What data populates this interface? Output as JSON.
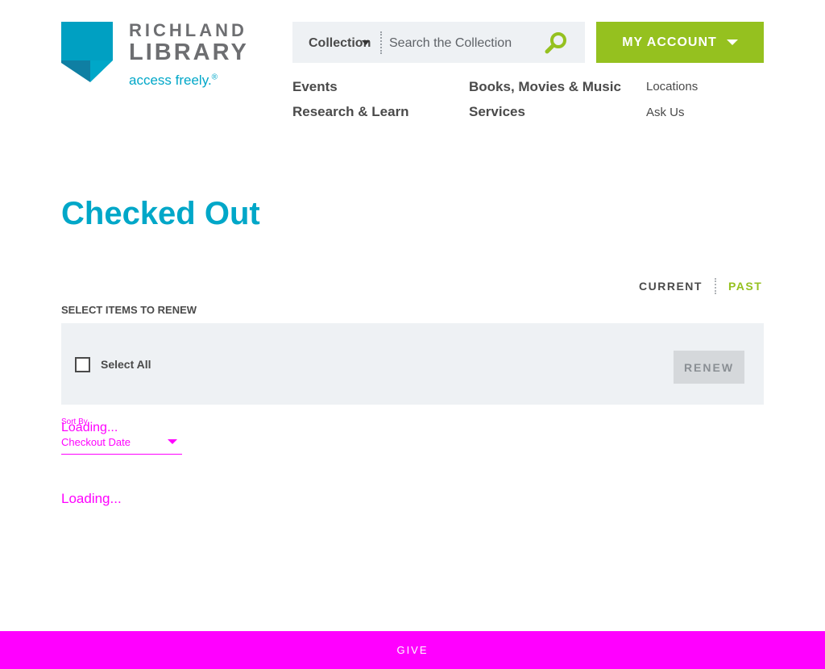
{
  "logo": {
    "line1": "RICHLAND",
    "line2": "LIBRARY",
    "tagline": "access freely.",
    "tagline_mark": "®"
  },
  "search": {
    "scope": "Collection",
    "placeholder": "Search the Collection"
  },
  "account": {
    "label": "MY ACCOUNT"
  },
  "nav": {
    "events": "Events",
    "research": "Research & Learn",
    "books": "Books, Movies & Music",
    "services": "Services",
    "locations": "Locations",
    "ask_us": "Ask Us"
  },
  "page": {
    "title": "Checked Out"
  },
  "tabs": {
    "current": "CURRENT",
    "past": "PAST"
  },
  "renew": {
    "heading": "SELECT ITEMS TO RENEW",
    "select_all": "Select All",
    "button": "RENEW"
  },
  "sort": {
    "label": "Sort By",
    "loading": "Loading...",
    "value": "Checkout Date"
  },
  "list": {
    "loading": "Loading..."
  },
  "footer": {
    "give": "GIVE"
  },
  "colors": {
    "teal": "#00a7c8",
    "green": "#95c11f",
    "magenta": "#ff00ff",
    "panel": "#eef1f4"
  },
  "icons": {
    "search": "search-icon",
    "dropdown": "chevron-down-icon"
  }
}
